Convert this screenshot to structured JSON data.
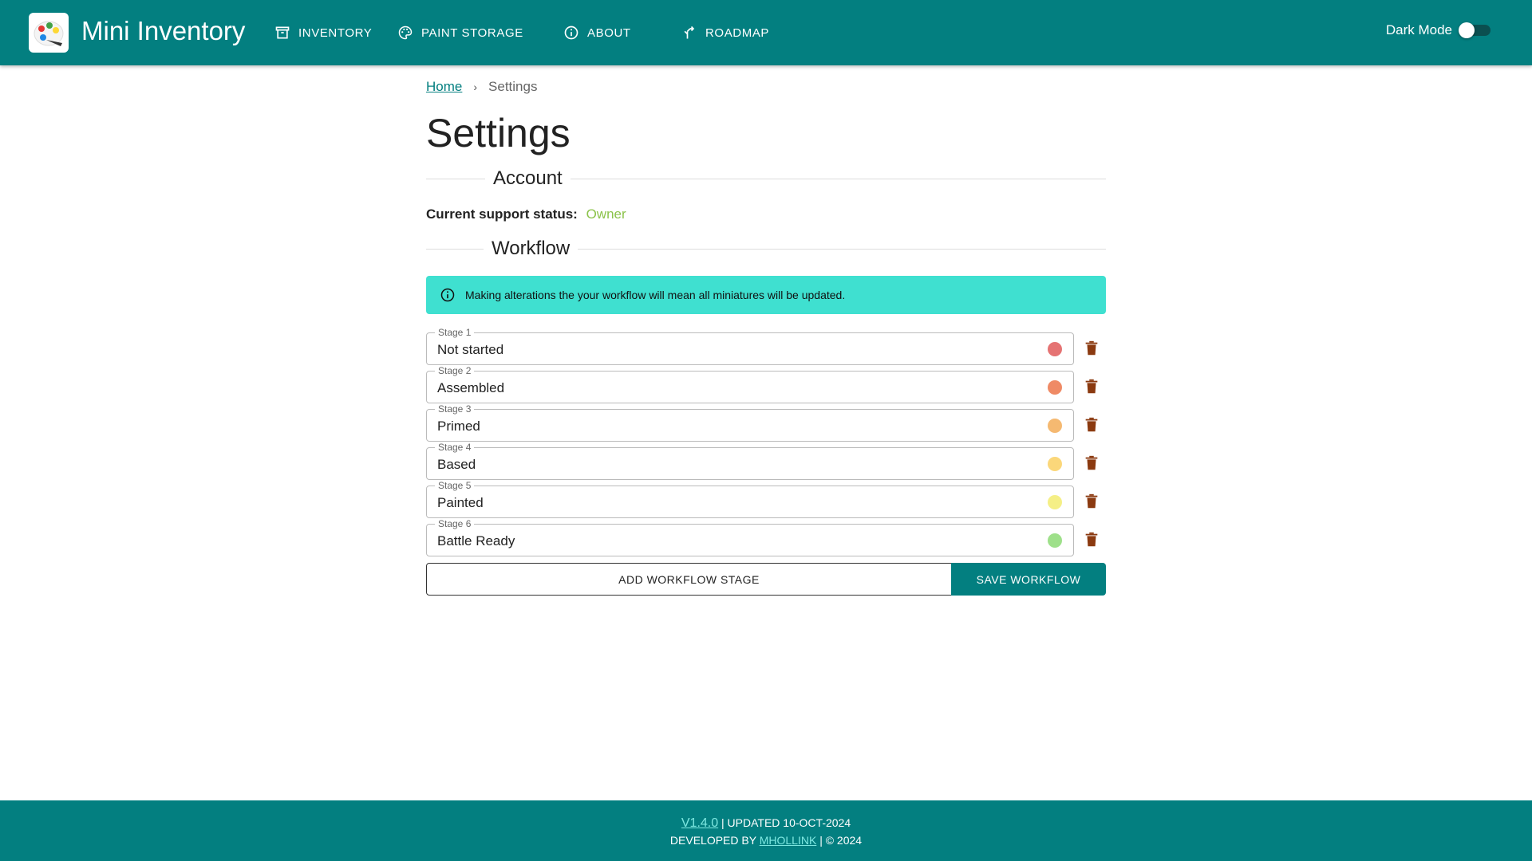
{
  "header": {
    "app_title": "Mini Inventory",
    "nav": [
      {
        "label": "INVENTORY",
        "icon": "archive-box-icon"
      },
      {
        "label": "PAINT STORAGE",
        "icon": "palette-icon"
      },
      {
        "label": "ABOUT",
        "icon": "info-icon"
      },
      {
        "label": "ROADMAP",
        "icon": "fork-arrow-icon"
      }
    ],
    "dark_mode_label": "Dark Mode",
    "dark_mode_on": false
  },
  "breadcrumb": {
    "home": "Home",
    "separator": "›",
    "current": "Settings"
  },
  "page_title": "Settings",
  "account": {
    "section_title": "Account",
    "support_label": "Current support status:",
    "support_value": "Owner"
  },
  "workflow": {
    "section_title": "Workflow",
    "alert_text": "Making alterations the your workflow will mean all miniatures will be updated.",
    "stages": [
      {
        "legend": "Stage 1",
        "value": "Not started",
        "color": "#e57373"
      },
      {
        "legend": "Stage 2",
        "value": "Assembled",
        "color": "#ef8a65"
      },
      {
        "legend": "Stage 3",
        "value": "Primed",
        "color": "#f5b971"
      },
      {
        "legend": "Stage 4",
        "value": "Based",
        "color": "#fbd77a"
      },
      {
        "legend": "Stage 5",
        "value": "Painted",
        "color": "#f5ef86"
      },
      {
        "legend": "Stage 6",
        "value": "Battle Ready",
        "color": "#9ee08a"
      }
    ],
    "add_label": "ADD WORKFLOW STAGE",
    "save_label": "SAVE WORKFLOW"
  },
  "footer": {
    "version": "V1.4.0",
    "updated": "| UPDATED 10-OCT-2024",
    "developed_by": "DEVELOPED BY",
    "author": "MHOLLINK",
    "copyright": "| © 2024"
  },
  "colors": {
    "primary": "#037f80",
    "alert_bg": "#3fe0d0",
    "owner": "#8bc34a",
    "delete": "#8b3a10"
  }
}
